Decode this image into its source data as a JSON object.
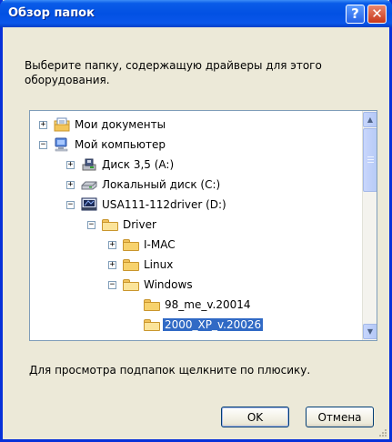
{
  "window": {
    "title": "Обзор папок",
    "help_glyph": "?",
    "close_glyph": "✕"
  },
  "instruction": "Выберите папку, содержащую драйверы для этого оборудования.",
  "tree": {
    "items": [
      {
        "label": "Мои документы",
        "expander": "+",
        "icon": "my-documents-icon",
        "selected": false
      },
      {
        "label": "Мой компьютер",
        "expander": "−",
        "icon": "my-computer-icon",
        "selected": false
      },
      {
        "label": "Диск 3,5 (A:)",
        "expander": "+",
        "icon": "floppy-drive-icon",
        "selected": false
      },
      {
        "label": "Локальный диск (C:)",
        "expander": "+",
        "icon": "hard-drive-icon",
        "selected": false
      },
      {
        "label": "USA111-112driver (D:)",
        "expander": "−",
        "icon": "cd-drive-icon",
        "selected": false
      },
      {
        "label": "Driver",
        "expander": "−",
        "icon": "folder-open-icon",
        "selected": false
      },
      {
        "label": "I-MAC",
        "expander": "+",
        "icon": "folder-icon",
        "selected": false
      },
      {
        "label": "Linux",
        "expander": "+",
        "icon": "folder-icon",
        "selected": false
      },
      {
        "label": "Windows",
        "expander": "−",
        "icon": "folder-open-icon",
        "selected": false
      },
      {
        "label": "98_me_v.20014",
        "expander": "",
        "icon": "folder-icon",
        "selected": false
      },
      {
        "label": "2000_XP_v.20026",
        "expander": "",
        "icon": "folder-open-icon",
        "selected": true
      }
    ]
  },
  "hint": "Для просмотра подпапок щелкните по плюсику.",
  "buttons": {
    "ok": "OK",
    "cancel": "Отмена"
  },
  "colors": {
    "titlebar": "#0251e3",
    "selection": "#316ac5",
    "dialog_bg": "#ece9d8"
  }
}
